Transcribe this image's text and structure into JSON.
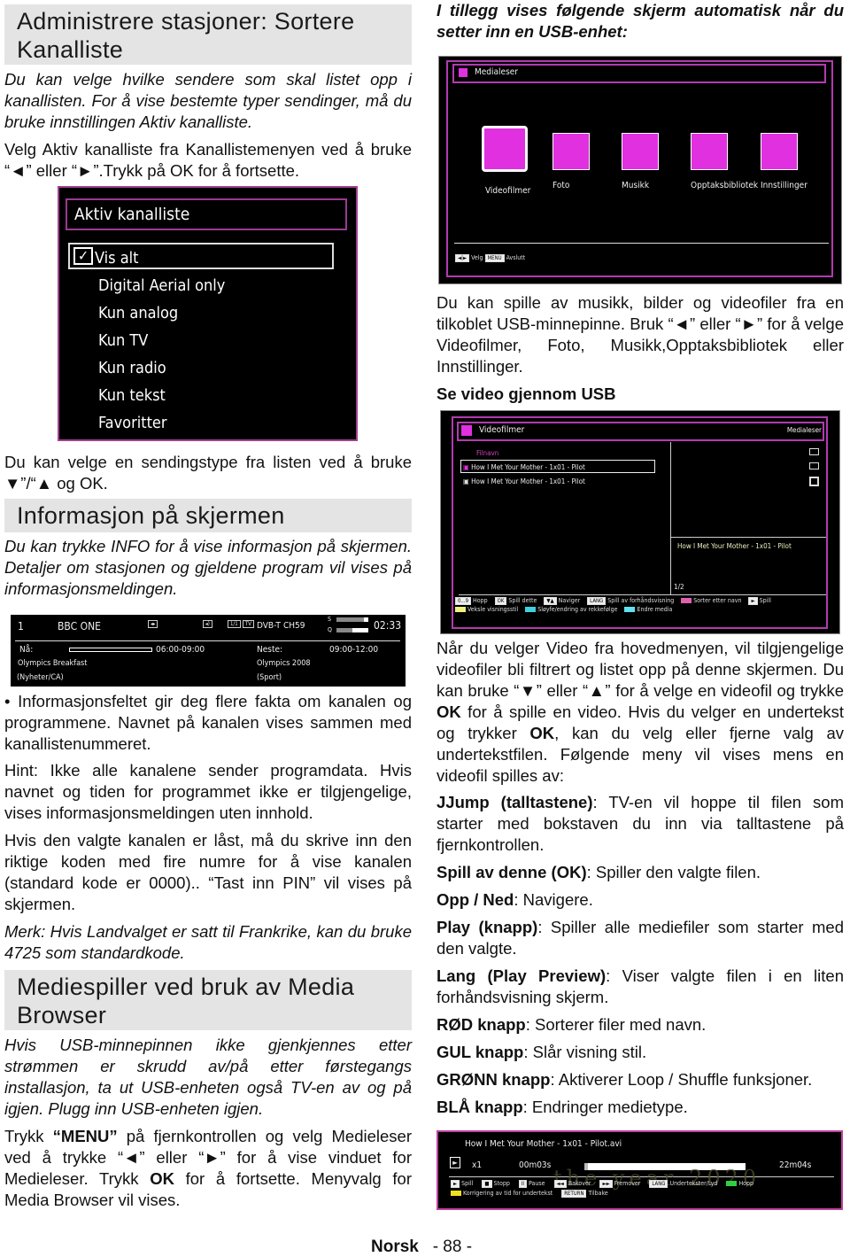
{
  "left": {
    "h1": "Administrere stasjoner: Sortere Kanalliste",
    "p1": "Du kan velge hvilke sendere som skal listet opp i kanallisten. For å vise bestemte typer sendinger, må du bruke innstillingen Aktiv kanalliste.",
    "p2": "Velg Aktiv kanalliste fra Kanallistemenyen ved å bruke “◄” eller “►”.Trykk på OK for å fortsette.",
    "channel_menu": {
      "title": "Aktiv kanalliste",
      "items": [
        "Vis alt",
        "Digital Aerial only",
        "Kun analog",
        "Kun TV",
        "Kun radio",
        "Kun tekst",
        "Favoritter"
      ],
      "selected": "Vis alt"
    },
    "p3": "Du kan velge en sendingstype fra listen ved å bruke ▼”/“▲ og OK.",
    "h2": "Informasjon på skjermen",
    "p4": "Du kan trykke INFO for å vise informasjon på skjermen. Detaljer om stasjonen og gjeldene program vil vises på informasjonsmeldingen.",
    "infobar": {
      "num": "1",
      "channel": "BBC ONE",
      "source": "DVB-T",
      "ch": "CH59",
      "s": "S",
      "q": "Q",
      "time": "02:33",
      "now_label": "Nå:",
      "now_time": "06:00-09:00",
      "now_title": "Olympics Breakfast",
      "now_genre": "(Nyheter/CA)",
      "next_label": "Neste:",
      "next_time": "09:00-12:00",
      "next_title": "Olympics 2008",
      "next_genre": "(Sport)",
      "tv_tag": "TV",
      "s_level": 0.85,
      "q_level": 0.5
    },
    "p5": "• Informasjonsfeltet gir deg flere fakta om kanalen og programmene. Navnet på kanalen vises sammen med kanallistenummeret.",
    "p6": "Hint: Ikke alle kanalene sender programdata. Hvis navnet og tiden for programmet ikke er tilgjengelige, vises informasjonsmeldingen uten innhold.",
    "p7": "Hvis den valgte kanalen er låst, må du skrive inn den riktige koden med fire numre for å vise kanalen (standard kode er 0000).. “Tast inn PIN” vil vises på skjermen.",
    "p8": "Merk: Hvis Landvalget er satt til Frankrike, kan du bruke 4725 som standardkode.",
    "h3": "Mediespiller ved bruk av Media Browser",
    "p9": "Hvis USB-minnepinnen ikke gjenkjennes etter strømmen er skrudd av/på etter førstegangs installasjon, ta ut USB-enheten også TV-en av og på igjen. Plugg inn USB-enheten  igjen.",
    "p10a": "Trykk ",
    "p10b": "“MENU”",
    "p10c": " på fjernkontrollen og velg Medieleser ved å trykke “◄” eller “►” for å vise vinduet for Medieleser. Trykk ",
    "p10d": "OK",
    "p10e": " for å fortsette.  Menyvalg for Media Browser vil vises."
  },
  "right": {
    "intro": "I tillegg vises følgende skjerm automatisk når du setter inn en USB-enhet:",
    "medialeser": {
      "title": "Medialeser",
      "tiles": [
        "Videofilmer",
        "Foto",
        "Musikk",
        "Opptaksbibliotek",
        "Innstillinger"
      ],
      "selected": "Videofilmer",
      "footer_velg": "Velg",
      "footer_menu_key": "MENU",
      "footer_avslutt": "Avslutt",
      "tile_color": "#e030e0"
    },
    "p1": "Du kan spille av musikk, bilder og videofiler fra en tilkoblet USB-minnepinne. Bruk “◄” eller “►” for å velge Videofilmer, Foto, Musikk,Opptaksbibliotek eller Innstillinger.",
    "sub": "Se video gjennom USB",
    "videofilmer": {
      "title": "Videofilmer",
      "right_title": "Medialeser",
      "col": "Filnavn",
      "files": [
        "How I Met Your Mother - 1x01 - Pilot",
        "How I Met Your Mother - 1x01 - Pilot"
      ],
      "preview": "How I Met Your Mother - 1x01 - Pilot",
      "page": "1/2",
      "legend": [
        {
          "key": "0...9",
          "label": "Hopp"
        },
        {
          "key": "OK",
          "label": "Spill dette"
        },
        {
          "key": "▼▲",
          "label": "Naviger"
        },
        {
          "key": "LANG",
          "label": "Spill av forhåndsvisning"
        },
        {
          "color": "#e060b0",
          "label": "Sorter etter navn"
        },
        {
          "key": "►",
          "label": "Spill"
        },
        {
          "color": "#f0f080",
          "label": "Veksle visningsstil"
        },
        {
          "color": "#40d0e0",
          "label": "Sløyfe/endring av rekkefølge"
        },
        {
          "color": "#60e0f0",
          "label": "Endre media"
        }
      ]
    },
    "p2a": "Når du velger Video fra hovedmenyen, vil tilgjengelige videofiler bli filtrert og listet opp på denne skjermen. Du kan bruke “▼” eller “▲” for å velge en videofil og trykke ",
    "p2b": "OK",
    "p2c": " for å spille en video. Hvis du velger en undertekst og trykker ",
    "p2d": "OK",
    "p2e": ", kan du velg eller fjerne valg av undertekstfilen. Følgende meny vil vises mens en videofil spilles av:",
    "defs": [
      {
        "term": "JJump (talltastene)",
        "desc": ": TV-en vil hoppe til filen som starter med bokstaven du inn via talltastene på fjernkontrollen."
      },
      {
        "term": "Spill av denne (OK)",
        "desc": ": Spiller den valgte filen."
      },
      {
        "term": "Opp / Ned",
        "desc": ": Navigere."
      },
      {
        "term": "Play (knapp)",
        "desc": ": Spiller alle mediefiler som starter med den valgte."
      },
      {
        "term": "Lang (Play Preview)",
        "desc": ": Viser valgte filen i en liten forhåndsvisning skjerm."
      },
      {
        "term": "RØD knapp",
        "desc": ": Sorterer filer med navn."
      },
      {
        "term": "GUL knapp",
        "desc": ": Slår visning stil."
      },
      {
        "term": "GRØNN knapp",
        "desc": ": Aktiverer Loop / Shuffle funksjoner."
      },
      {
        "term": "BLÅ knapp",
        "desc": ": Endringer medietype."
      }
    ],
    "player": {
      "file": "How I Met Your Mother - 1x01 - Pilot.avi",
      "speed": "x1",
      "elapsed": "00m03s",
      "total": "22m04s",
      "progress": 0.02,
      "watermark": "the year 2020",
      "legend": [
        {
          "key": "►",
          "label": "Spill"
        },
        {
          "key": "■",
          "label": "Stopp"
        },
        {
          "key": "II",
          "label": "Pause"
        },
        {
          "key": "◄◄",
          "label": "Bakover"
        },
        {
          "key": "►►",
          "label": "Fremover"
        },
        {
          "key": "LANG",
          "label": "Undertekster/Lyd"
        },
        {
          "color": "#30d040",
          "label": "Hopp"
        },
        {
          "color": "#f0e020",
          "label": "Korrigering av tid for undertekst"
        },
        {
          "key": "RETURN",
          "label": "Tilbake"
        }
      ]
    }
  },
  "footer": {
    "lang": "Norsk",
    "page": "- 88 -"
  }
}
